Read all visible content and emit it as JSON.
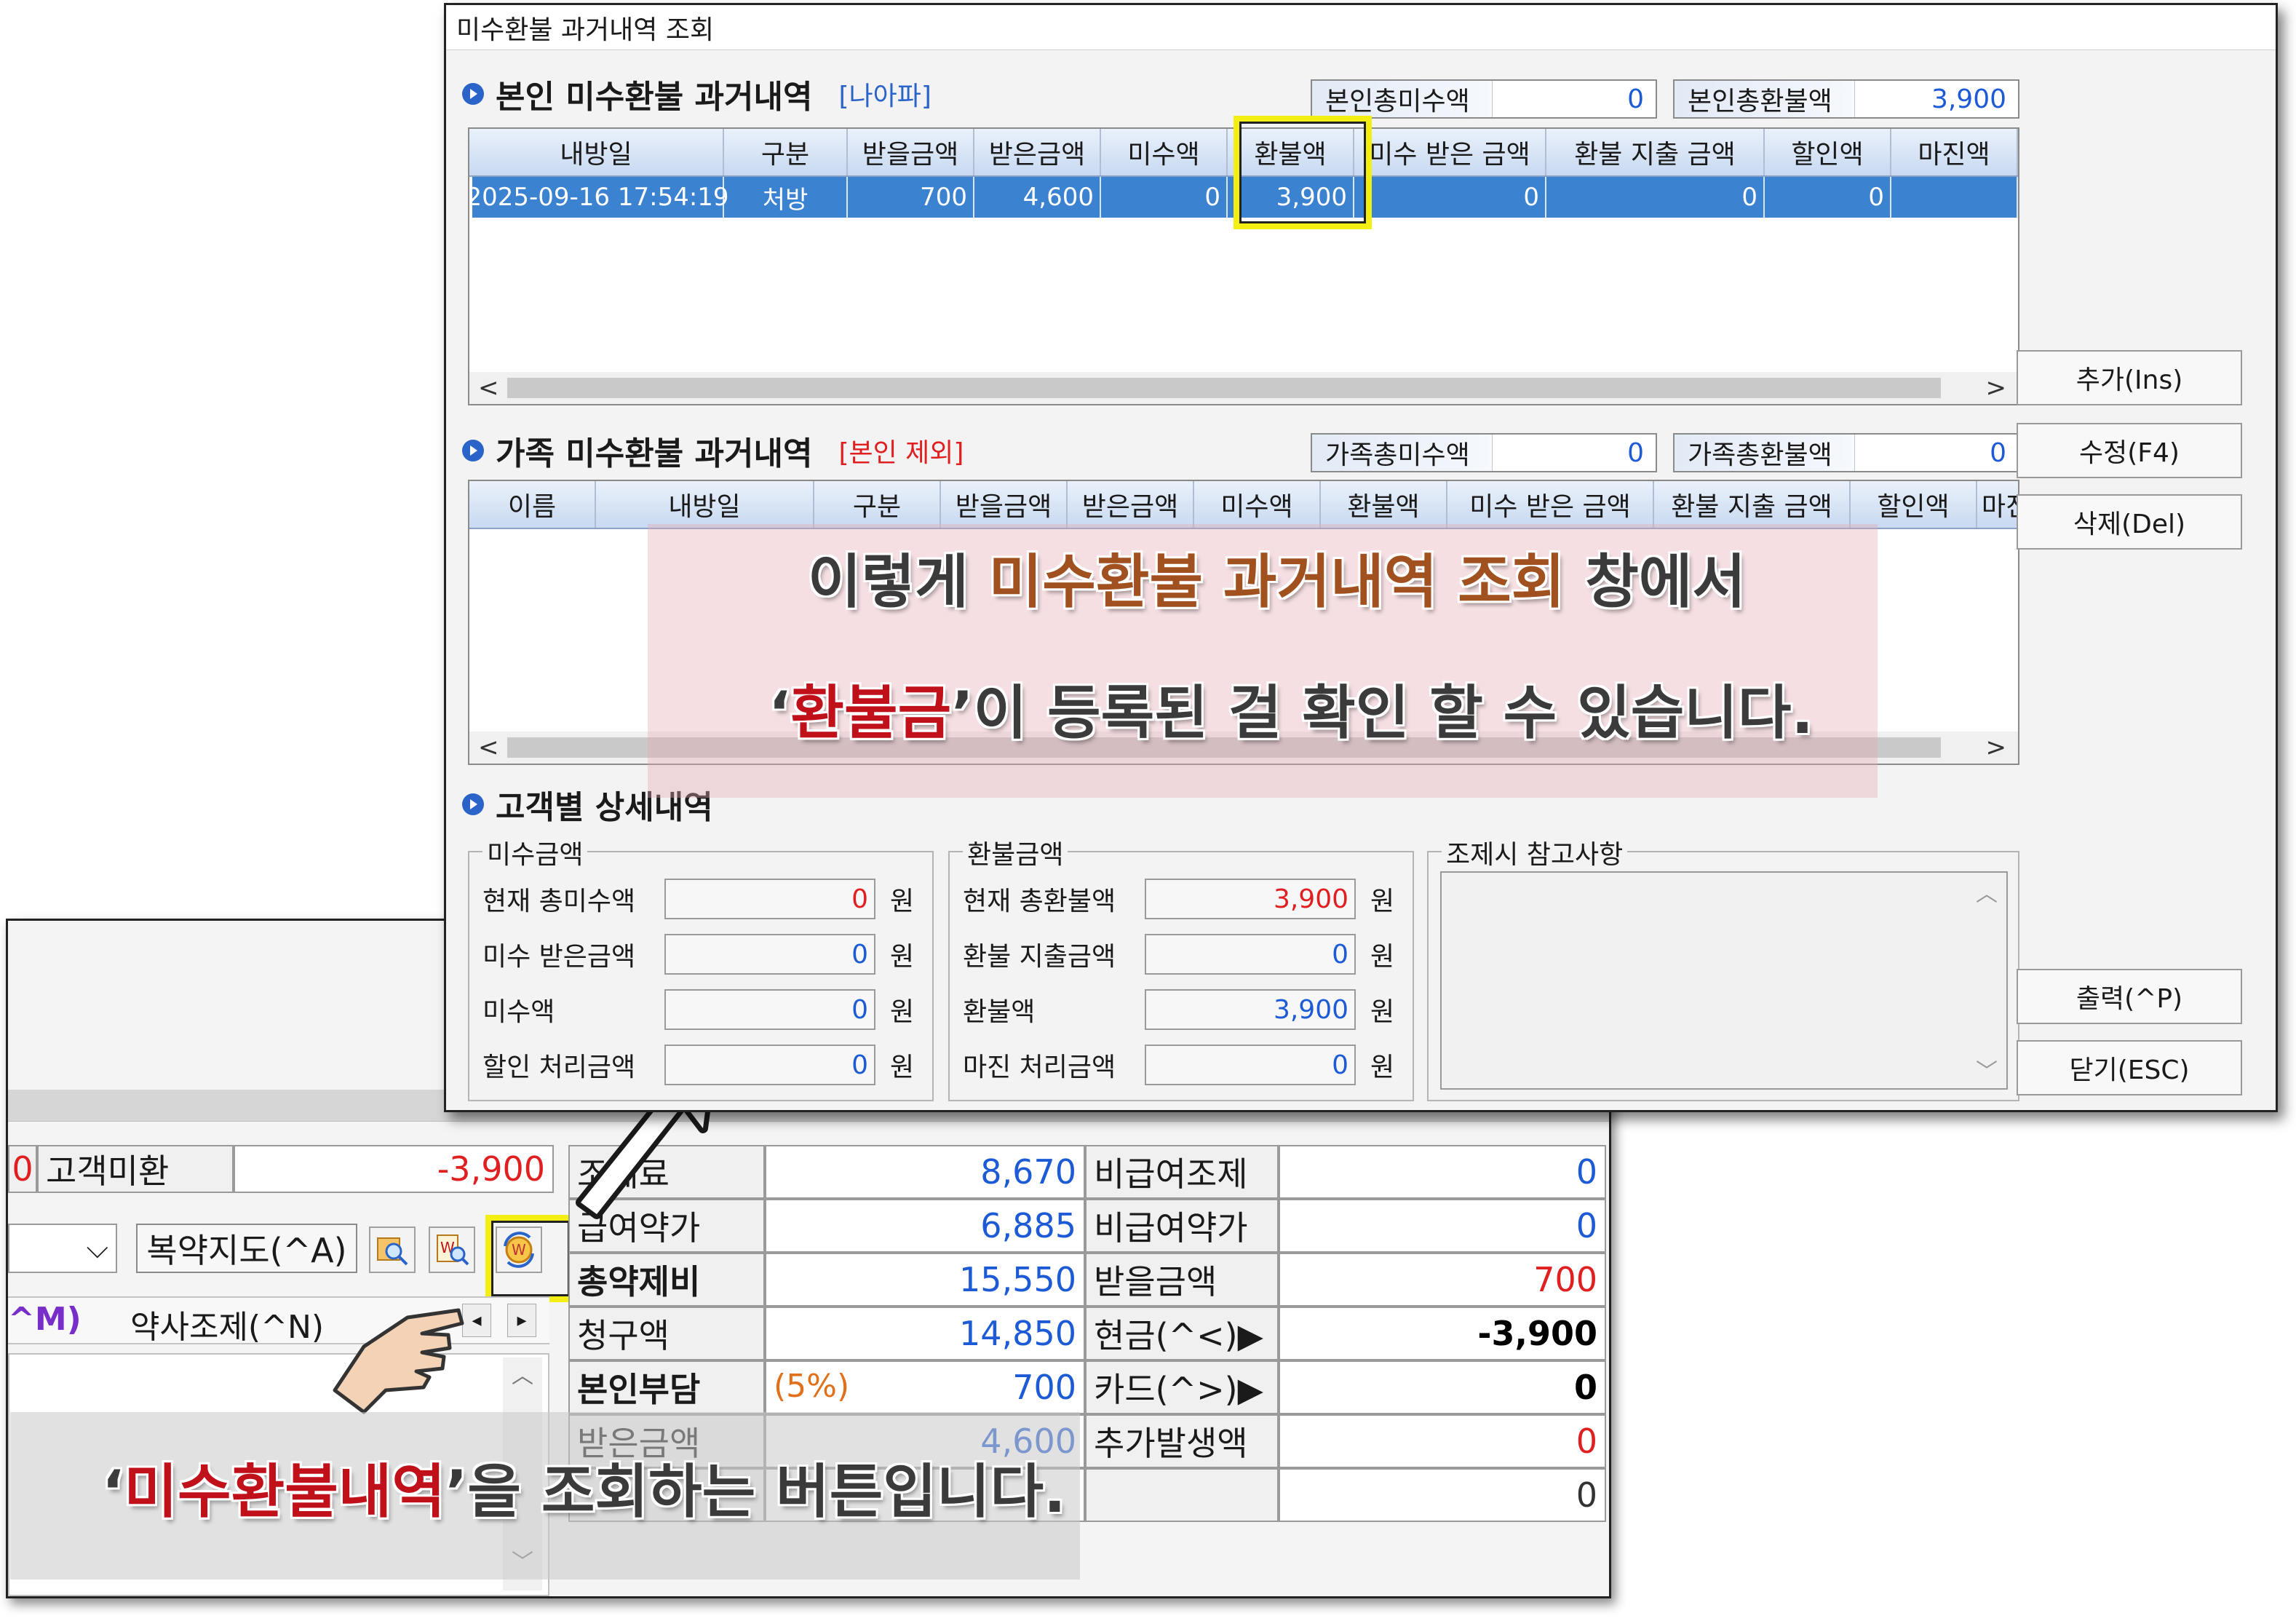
{
  "dialog": {
    "title": "미수환불 과거내역 조회",
    "own_section": {
      "title": "본인 미수환불 과거내역",
      "tag": "[나아파]",
      "total_unpaid_label": "본인총미수액",
      "total_unpaid_value": "0",
      "total_refund_label": "본인총환불액",
      "total_refund_value": "3,900",
      "columns": [
        "내방일",
        "구분",
        "받을금액",
        "받은금액",
        "미수액",
        "환불액",
        "미수 받은 금액",
        "환불 지출 금액",
        "할인액",
        "마진액"
      ],
      "rows": [
        [
          "2025-09-16 17:54:19",
          "처방",
          "700",
          "4,600",
          "0",
          "3,900",
          "0",
          "0",
          "0",
          ""
        ]
      ]
    },
    "family_section": {
      "title": "가족 미수환불 과거내역",
      "tag": "[본인 제외]",
      "total_unpaid_label": "가족총미수액",
      "total_unpaid_value": "0",
      "total_refund_label": "가족총환불액",
      "total_refund_value": "0",
      "columns": [
        "이름",
        "내방일",
        "구분",
        "받을금액",
        "받은금액",
        "미수액",
        "환불액",
        "미수 받은 금액",
        "환불 지출 금액",
        "할인액",
        "마진"
      ]
    },
    "detail_section": {
      "title": "고객별 상세내역",
      "unpaid_group": {
        "title": "미수금액",
        "rows": [
          {
            "label": "현재 총미수액",
            "value": "0",
            "unit": "원"
          },
          {
            "label": "미수 받은금액",
            "value": "0",
            "unit": "원"
          },
          {
            "label": "미수액",
            "value": "0",
            "unit": "원"
          },
          {
            "label": "할인 처리금액",
            "value": "0",
            "unit": "원"
          }
        ]
      },
      "refund_group": {
        "title": "환불금액",
        "rows": [
          {
            "label": "현재 총환불액",
            "value": "3,900",
            "unit": "원"
          },
          {
            "label": "환불 지출금액",
            "value": "0",
            "unit": "원"
          },
          {
            "label": "환불액",
            "value": "3,900",
            "unit": "원"
          },
          {
            "label": "마진 처리금액",
            "value": "0",
            "unit": "원"
          }
        ]
      },
      "memo_group": {
        "title": "조제시 참고사항"
      }
    },
    "buttons": {
      "add": "추가(Ins)",
      "edit": "수정(F4)",
      "delete": "삭제(Del)",
      "print": "출력(^P)",
      "close": "닫기(ESC)"
    }
  },
  "main": {
    "unpaid_prefix": "0",
    "customer_unpaid_label": "고객미환",
    "customer_unpaid_value": "-3,900",
    "rows": [
      {
        "label": "조제료",
        "value": "8,670",
        "label2": "비급여조제",
        "value2": "0"
      },
      {
        "label": "급여약가",
        "value": "6,885",
        "label2": "비급여약가",
        "value2": "0"
      },
      {
        "label": "총약제비",
        "value": "15,550",
        "label2": "받을금액",
        "value2": "700"
      },
      {
        "label": "청구액",
        "value": "14,850",
        "label2": "현금(^<)▶",
        "value2": "-3,900"
      },
      {
        "label": "본인부담",
        "note": "(5%)",
        "value": "700",
        "label2": "카드(^>)▶",
        "value2": "0"
      },
      {
        "label": "받은금액",
        "value": "4,600",
        "label2": "추가발생액",
        "value2": "0"
      },
      {
        "label": "",
        "value": "",
        "label2": "",
        "value2": "0"
      }
    ],
    "pharmacist_button": "복약지도(^A)",
    "label_m": "^M)",
    "pharmacist_tab": "약사조제(^N)"
  },
  "callouts": {
    "top_line1_a": "이렇게 ",
    "top_line1_b": "미수환불 과거내역 조회",
    "top_line1_c": " 창에서",
    "top_line2_a": "‘",
    "top_line2_b": "환불금",
    "top_line2_c": "’이 등록된 걸 확인 할 수 있습니다.",
    "bottom_a": "‘",
    "bottom_b": "미수환불내역",
    "bottom_c": "’을 조회하는 버튼입니다."
  },
  "colors": {
    "selected_row": "#3b82d1",
    "highlight": "#f3ef12",
    "value_blue": "#1d5bd6",
    "value_red": "#e02020"
  }
}
